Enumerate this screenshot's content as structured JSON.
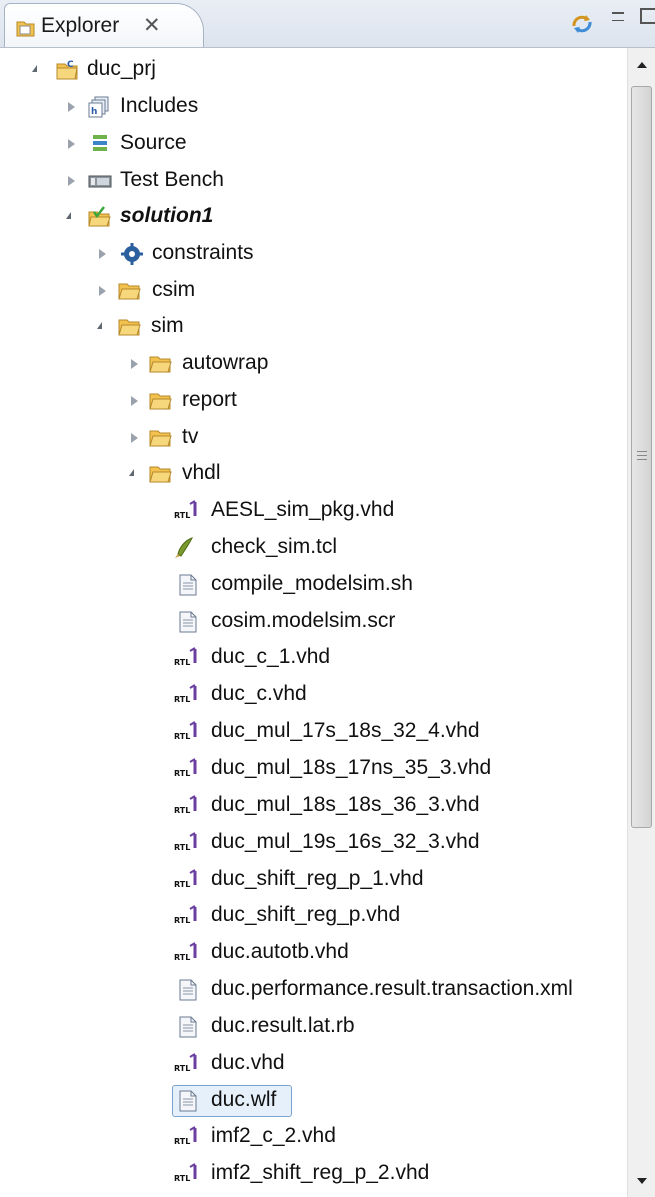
{
  "tab": {
    "title": "Explorer",
    "close_glyph": "✕"
  },
  "tree": {
    "root": "duc_prj",
    "includes": "Includes",
    "source": "Source",
    "test_bench": "Test Bench",
    "solution": "solution1",
    "constraints": "constraints",
    "csim": "csim",
    "sim": "sim",
    "autowrap": "autowrap",
    "report": "report",
    "tv": "tv",
    "vhdl": "vhdl",
    "files": [
      {
        "name": "AESL_sim_pkg.vhd",
        "icon": "rtl-icon"
      },
      {
        "name": "check_sim.tcl",
        "icon": "tcl-icon"
      },
      {
        "name": "compile_modelsim.sh",
        "icon": "text-file-icon"
      },
      {
        "name": "cosim.modelsim.scr",
        "icon": "text-file-icon"
      },
      {
        "name": "duc_c_1.vhd",
        "icon": "rtl-icon"
      },
      {
        "name": "duc_c.vhd",
        "icon": "rtl-icon"
      },
      {
        "name": "duc_mul_17s_18s_32_4.vhd",
        "icon": "rtl-icon"
      },
      {
        "name": "duc_mul_18s_17ns_35_3.vhd",
        "icon": "rtl-icon"
      },
      {
        "name": "duc_mul_18s_18s_36_3.vhd",
        "icon": "rtl-icon"
      },
      {
        "name": "duc_mul_19s_16s_32_3.vhd",
        "icon": "rtl-icon"
      },
      {
        "name": "duc_shift_reg_p_1.vhd",
        "icon": "rtl-icon"
      },
      {
        "name": "duc_shift_reg_p.vhd",
        "icon": "rtl-icon"
      },
      {
        "name": "duc.autotb.vhd",
        "icon": "rtl-icon"
      },
      {
        "name": "duc.performance.result.transaction.xml",
        "icon": "text-file-icon"
      },
      {
        "name": "duc.result.lat.rb",
        "icon": "text-file-icon"
      },
      {
        "name": "duc.vhd",
        "icon": "rtl-icon"
      },
      {
        "name": "duc.wlf",
        "icon": "text-file-icon",
        "selected": true
      },
      {
        "name": "imf2_c_2.vhd",
        "icon": "rtl-icon"
      },
      {
        "name": "imf2_shift_reg_p_2.vhd",
        "icon": "rtl-icon"
      }
    ],
    "rtl_badge": "RTL"
  },
  "colors": {
    "folder": "#f2c14e",
    "selection_bg": "#e6f0fb",
    "selection_border": "#7da2ce"
  }
}
